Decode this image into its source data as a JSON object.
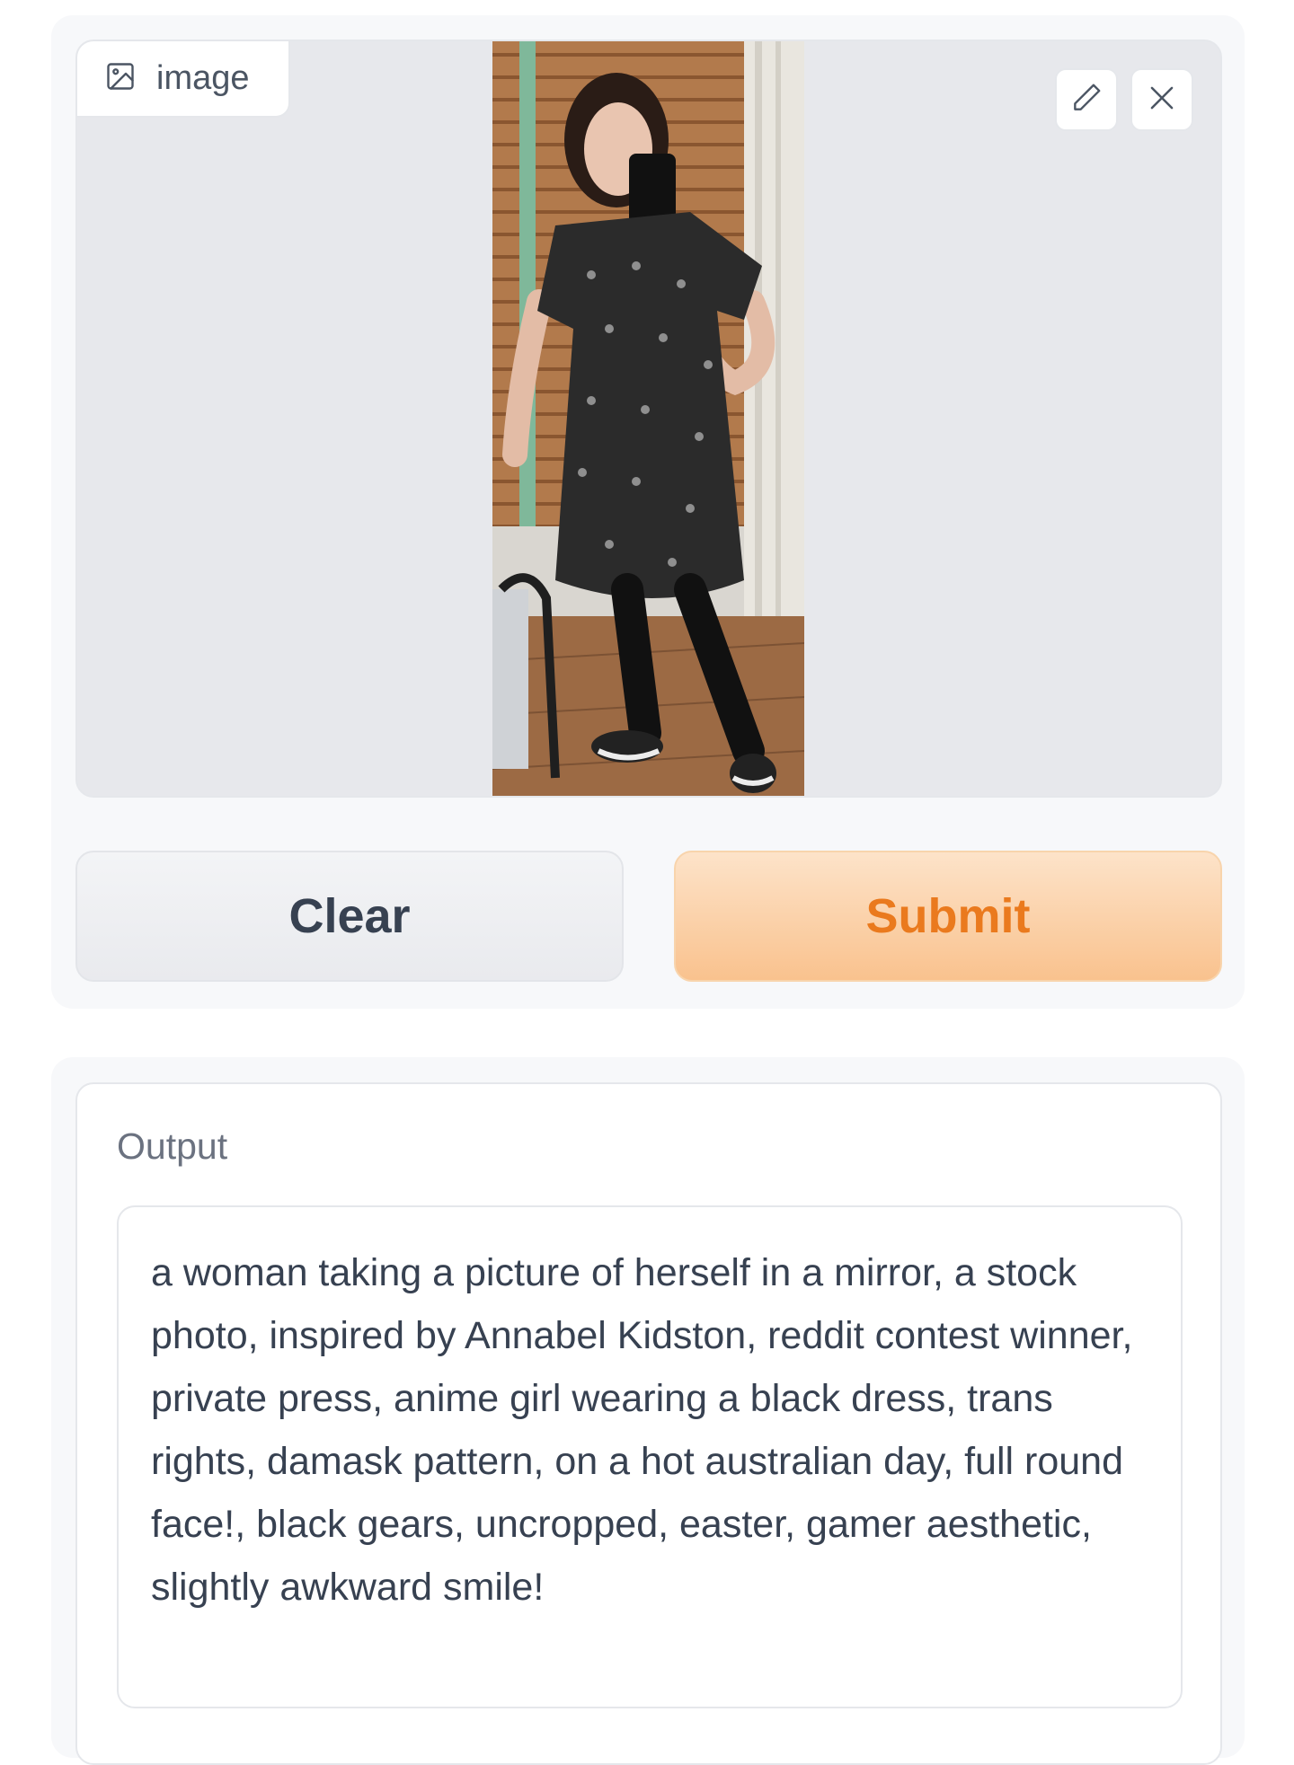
{
  "image_input": {
    "label": "image",
    "label_icon": "image-icon",
    "edit_icon": "pencil-icon",
    "close_icon": "close-icon"
  },
  "buttons": {
    "clear_label": "Clear",
    "submit_label": "Submit"
  },
  "output": {
    "label": "Output",
    "text": "a woman taking a picture of herself in a mirror, a stock photo, inspired by Annabel Kidston, reddit contest winner, private press, anime girl wearing a black dress, trans rights, damask pattern, on a hot australian day, full round face!, black gears, uncropped, easter, gamer aesthetic, slightly awkward smile!"
  },
  "colors": {
    "panel_bg": "#f7f8fa",
    "image_bg": "#e7e8ec",
    "submit_text": "#ea7a1e",
    "submit_bg": "#f9c28e",
    "clear_text": "#374151"
  }
}
